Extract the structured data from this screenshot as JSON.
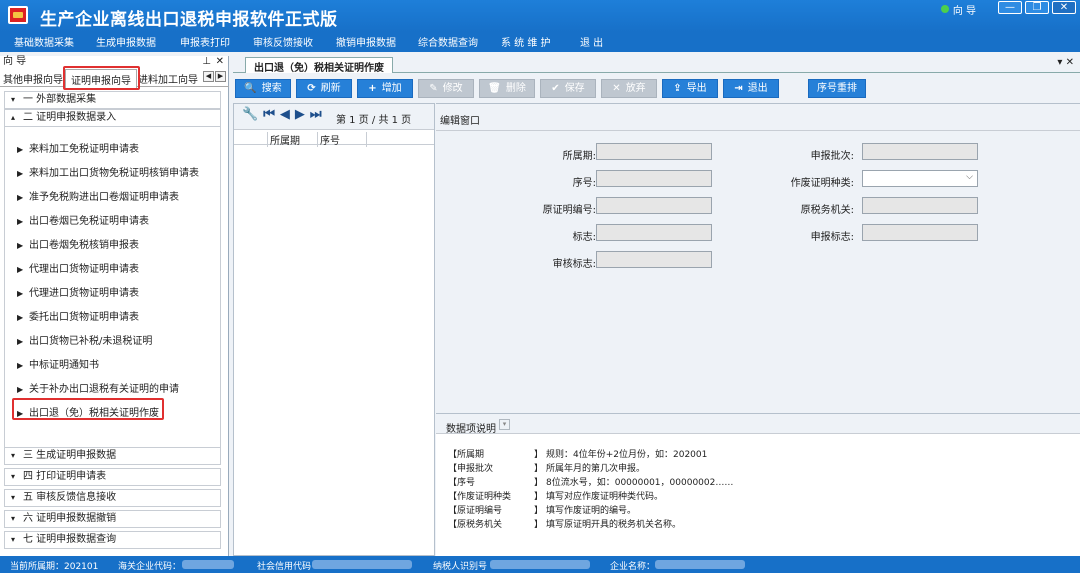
{
  "window": {
    "title": "生产企业离线出口退税申报软件正式版",
    "guide_label": "向 导",
    "minimize": "—",
    "maximize": "❐",
    "close": "✕"
  },
  "menu": [
    "基础数据采集",
    "生成申报数据",
    "申报表打印",
    "审核反馈接收",
    "撤销申报数据",
    "综合数据查询",
    "系 统 维 护",
    "退  出"
  ],
  "left_panel": {
    "title": "向 导",
    "pin": "⊥",
    "close": "✕",
    "tabs": [
      "其他申报向导",
      "证明申报向导",
      "进料加工向导"
    ],
    "sections_top": [
      "一  外部数据采集",
      "二  证明申报数据录入"
    ],
    "items": [
      "来料加工免税证明申请表",
      "来料加工出口货物免税证明核销申请表",
      "准予免税购进出口卷烟证明申请表",
      "出口卷烟已免税证明申请表",
      "出口卷烟免税核销申报表",
      "代理出口货物证明申请表",
      "代理进口货物证明申请表",
      "委托出口货物证明申请表",
      "出口货物已补税/未退税证明",
      "中标证明通知书",
      "关于补办出口退税有关证明的申请",
      "出口退（免）税相关证明作废"
    ],
    "sections_bottom": [
      "三  生成证明申报数据",
      "四  打印证明申请表",
      "五  审核反馈信息接收",
      "六  证明申报数据撤销",
      "七  证明申报数据查询"
    ]
  },
  "doc_tab": {
    "label": "出口退（免）税相关证明作废",
    "controls": "▾ ✕"
  },
  "toolbar": [
    {
      "icon": "🔍",
      "label": "搜索",
      "enabled": true
    },
    {
      "icon": "⟳",
      "label": "刷新",
      "enabled": true
    },
    {
      "icon": "+",
      "label": "增加",
      "enabled": true
    },
    {
      "icon": "✎",
      "label": "修改",
      "enabled": false
    },
    {
      "icon": "🗑",
      "label": "删除",
      "enabled": false
    },
    {
      "icon": "✔",
      "label": "保存",
      "enabled": false
    },
    {
      "icon": "✕",
      "label": "放弃",
      "enabled": false
    },
    {
      "icon": "⇪",
      "label": "导出",
      "enabled": true
    },
    {
      "icon": "⇥",
      "label": "退出",
      "enabled": true
    },
    {
      "icon": "",
      "label": "序号重排",
      "enabled": true
    }
  ],
  "pager": {
    "text": "第 1 页 / 共 1 页",
    "icons": [
      "🔧",
      "⏮",
      "◀",
      "▶",
      "⏭"
    ]
  },
  "list_columns": [
    "所属期",
    "序号"
  ],
  "edit": {
    "title": "编辑窗口",
    "fields_left": [
      "所属期:",
      "序号:",
      "原证明编号:",
      "标志:",
      "审核标志:"
    ],
    "fields_right": [
      "申报批次:",
      "作废证明种类:",
      "原税务机关:",
      "申报标志:"
    ]
  },
  "desc": {
    "title": "数据项说明",
    "rows": [
      {
        "key": "【所属期",
        "bracket": "】",
        "value": "规则：4位年份+2位月份，如：202001"
      },
      {
        "key": "【申报批次",
        "bracket": "】",
        "value": "所属年月的第几次申报。"
      },
      {
        "key": "【序号",
        "bracket": "】",
        "value": "8位流水号，如：00000001，00000002……"
      },
      {
        "key": "【作废证明种类",
        "bracket": "】",
        "value": "填写对应作废证明种类代码。"
      },
      {
        "key": "【原证明编号",
        "bracket": "】",
        "value": "填写作废证明的编号。"
      },
      {
        "key": "【原税务机关",
        "bracket": "】",
        "value": "填写原证明开具的税务机关名称。"
      }
    ]
  },
  "status": {
    "period": "当前所属期：202101",
    "customs": "海关企业代码：",
    "credit": "社会信用代码",
    "taxpayer": "纳税人识别号",
    "company": "企业名称："
  }
}
